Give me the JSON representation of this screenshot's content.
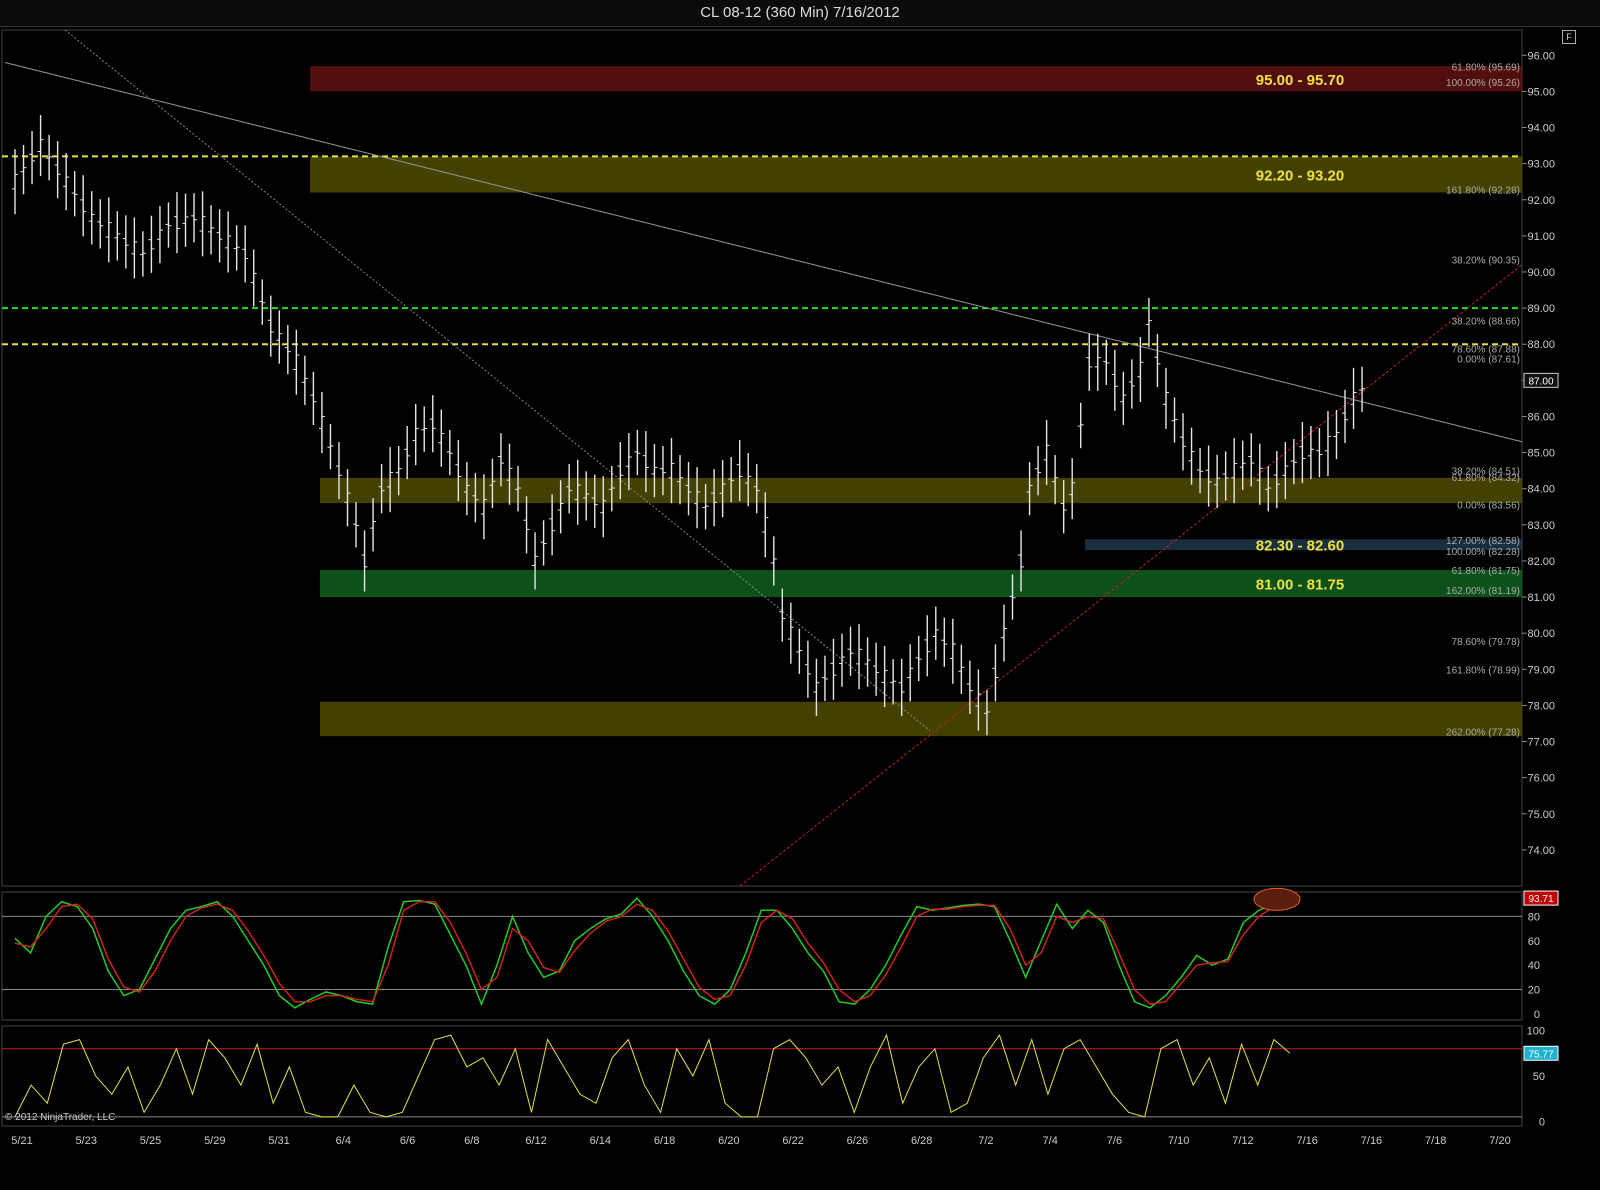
{
  "window": {
    "title": "CL 08-12 (360 Min)  7/16/2012",
    "corner_icon": "F"
  },
  "copyright": "© 2012 NinjaTrader, LLC",
  "chart_data": [
    {
      "type": "ohlc",
      "panel": "price",
      "ylim": [
        73,
        96.7
      ],
      "yticks": [
        74,
        75,
        76,
        77,
        78,
        79,
        80,
        81,
        82,
        83,
        84,
        85,
        86,
        87,
        88,
        89,
        90,
        91,
        92,
        93,
        94,
        95,
        96
      ],
      "ytick_labels": [
        "74.00",
        "75.00",
        "76.00",
        "77.00",
        "78.00",
        "79.00",
        "80.00",
        "81.00",
        "82.00",
        "83.00",
        "84.00",
        "85.00",
        "86.00",
        "87.00",
        "88.00",
        "89.00",
        "90.00",
        "91.00",
        "92.00",
        "93.00",
        "94.00",
        "95.00",
        "96.00"
      ],
      "xlabels": [
        "5/21",
        "5/23",
        "5/25",
        "5/29",
        "5/31",
        "6/4",
        "6/6",
        "6/8",
        "6/12",
        "6/14",
        "6/18",
        "6/20",
        "6/22",
        "6/26",
        "6/28",
        "7/2",
        "7/4",
        "7/6",
        "7/10",
        "7/12",
        "7/16",
        "7/16",
        "7/18",
        "7/20"
      ],
      "last_price": "87.00",
      "price_path": [
        [
          0,
          92.5
        ],
        [
          3,
          93.5
        ],
        [
          6,
          92.5
        ],
        [
          9,
          91.5
        ],
        [
          12,
          91
        ],
        [
          15,
          90.5
        ],
        [
          18,
          91.3
        ],
        [
          21,
          91.5
        ],
        [
          24,
          91
        ],
        [
          27,
          90.5
        ],
        [
          30,
          88.5
        ],
        [
          31,
          88.2
        ],
        [
          33,
          87.5
        ],
        [
          35,
          86.5
        ],
        [
          38,
          84.5
        ],
        [
          40,
          83
        ],
        [
          41,
          82
        ],
        [
          43,
          84
        ],
        [
          45,
          84.5
        ],
        [
          47,
          85.5
        ],
        [
          49,
          85.8
        ],
        [
          51,
          85
        ],
        [
          53,
          84
        ],
        [
          55,
          83.5
        ],
        [
          57,
          84.8
        ],
        [
          59,
          84
        ],
        [
          61,
          82
        ],
        [
          63,
          83
        ],
        [
          65,
          84
        ],
        [
          67,
          83.8
        ],
        [
          69,
          83.5
        ],
        [
          71,
          84.5
        ],
        [
          73,
          85
        ],
        [
          75,
          84.5
        ],
        [
          77,
          84.5
        ],
        [
          79,
          84
        ],
        [
          81,
          83.5
        ],
        [
          83,
          84
        ],
        [
          85,
          84.5
        ],
        [
          87,
          84
        ],
        [
          89,
          82
        ],
        [
          90,
          80.5
        ],
        [
          92,
          79.5
        ],
        [
          94,
          78.5
        ],
        [
          96,
          79
        ],
        [
          98,
          79.5
        ],
        [
          100,
          79.2
        ],
        [
          102,
          78.8
        ],
        [
          104,
          78.5
        ],
        [
          106,
          79.3
        ],
        [
          108,
          80
        ],
        [
          110,
          79.5
        ],
        [
          112,
          78.5
        ],
        [
          114,
          77.8
        ],
        [
          116,
          80
        ],
        [
          118,
          82
        ],
        [
          119,
          84
        ],
        [
          121,
          85
        ],
        [
          123,
          83.5
        ],
        [
          124,
          84
        ],
        [
          126,
          87.5
        ],
        [
          128,
          87.5
        ],
        [
          130,
          86.5
        ],
        [
          132,
          87.3
        ],
        [
          133,
          88.6
        ],
        [
          135,
          86.5
        ],
        [
          137,
          85.3
        ],
        [
          139,
          84.5
        ],
        [
          141,
          84.2
        ],
        [
          143,
          84.5
        ],
        [
          145,
          84.8
        ],
        [
          147,
          84
        ],
        [
          149,
          84.5
        ],
        [
          151,
          85
        ],
        [
          153,
          85
        ],
        [
          155,
          85.5
        ],
        [
          157,
          86.5
        ],
        [
          159,
          87
        ]
      ],
      "range_labels": [
        {
          "text": "95.00 - 95.70",
          "low": 95.0,
          "high": 95.7,
          "color": "#5a0f0f"
        },
        {
          "text": "92.20 - 93.20",
          "low": 92.2,
          "high": 93.2,
          "color": "#4a4800"
        },
        {
          "text": "",
          "low": 83.6,
          "high": 84.3,
          "color": "#4a4800"
        },
        {
          "text": "82.30 - 82.60",
          "low": 82.3,
          "high": 82.6,
          "color": "#1b3448"
        },
        {
          "text": "81.00  - 81.75",
          "low": 81.0,
          "high": 81.75,
          "color": "#0c5a1c"
        },
        {
          "text": "",
          "low": 77.15,
          "high": 78.1,
          "color": "#4a4800"
        }
      ],
      "fib_labels": [
        "61.80% (95.69)",
        "100.00% (95.26)",
        "161.80% (92.28)",
        "38.20% (90.35)",
        "38.20% (88.66)",
        "78.60% (87.88)",
        "0.00% (87.61)",
        "38.20% (84.51)",
        "61.80% (84.32)",
        "0.00% (83.56)",
        "127.00% (82.58)",
        "100.00% (82.28)",
        "61.80% (81.75)",
        "162.00% (81.19)",
        "78.60% (79.78)",
        "161.80% (78.99)",
        "262.00% (77.28)"
      ],
      "dashed_levels": [
        {
          "price": 93.2,
          "color": "#e8e040"
        },
        {
          "price": 89.0,
          "color": "#22dd22"
        },
        {
          "price": 88.0,
          "color": "#e8e040"
        }
      ]
    },
    {
      "type": "line",
      "panel": "stochastics",
      "ylim": [
        -5,
        100
      ],
      "yticks": [
        0,
        20,
        40,
        60,
        80
      ],
      "ytick_labels": [
        "0",
        "20",
        "40",
        "60",
        "80"
      ],
      "series": [
        {
          "color": "#22cc22",
          "values": [
            62,
            50,
            80,
            92,
            88,
            70,
            35,
            15,
            20,
            45,
            70,
            85,
            88,
            92,
            80,
            60,
            40,
            15,
            5,
            12,
            18,
            15,
            10,
            8,
            55,
            92,
            93,
            90,
            65,
            40,
            8,
            40,
            80,
            50,
            30,
            35,
            60,
            70,
            78,
            82,
            95,
            80,
            60,
            35,
            15,
            8,
            20,
            50,
            85,
            85,
            70,
            50,
            35,
            10,
            8,
            20,
            40,
            65,
            88,
            85,
            87,
            89,
            90,
            88,
            60,
            30,
            60,
            90,
            70,
            85,
            75,
            40,
            10,
            5,
            15,
            30,
            48,
            40,
            45,
            75,
            85,
            90,
            95
          ]
        },
        {
          "color": "#cc2222",
          "values": [
            58,
            55,
            70,
            88,
            90,
            78,
            45,
            22,
            18,
            35,
            60,
            80,
            87,
            90,
            85,
            68,
            48,
            25,
            10,
            10,
            15,
            15,
            12,
            10,
            40,
            85,
            92,
            92,
            75,
            50,
            20,
            30,
            70,
            60,
            38,
            34,
            52,
            66,
            76,
            80,
            90,
            85,
            68,
            45,
            22,
            12,
            15,
            40,
            75,
            85,
            78,
            58,
            42,
            20,
            10,
            15,
            32,
            55,
            80,
            86,
            86,
            88,
            89,
            89,
            70,
            40,
            50,
            80,
            75,
            80,
            78,
            50,
            20,
            8,
            10,
            25,
            40,
            42,
            43,
            65,
            80,
            88,
            92
          ]
        }
      ],
      "readout": "93.71"
    },
    {
      "type": "line",
      "panel": "rsi",
      "ylim": [
        -5,
        105
      ],
      "yticks": [
        0,
        50,
        100
      ],
      "ytick_labels": [
        "0",
        "50",
        "100"
      ],
      "series": [
        {
          "color": "#e8e040",
          "values": [
            5,
            40,
            20,
            85,
            90,
            50,
            30,
            60,
            10,
            40,
            80,
            30,
            90,
            70,
            40,
            85,
            20,
            60,
            10,
            5,
            5,
            40,
            10,
            5,
            10,
            50,
            90,
            95,
            60,
            70,
            40,
            80,
            10,
            90,
            60,
            30,
            20,
            70,
            90,
            40,
            10,
            80,
            50,
            90,
            20,
            5,
            5,
            80,
            90,
            70,
            40,
            60,
            10,
            60,
            95,
            20,
            60,
            80,
            10,
            20,
            70,
            95,
            40,
            90,
            30,
            80,
            90,
            60,
            30,
            10,
            5,
            80,
            90,
            40,
            70,
            20,
            85,
            40,
            90,
            75
          ]
        }
      ],
      "overbought": 80,
      "readout": "75.77"
    }
  ]
}
